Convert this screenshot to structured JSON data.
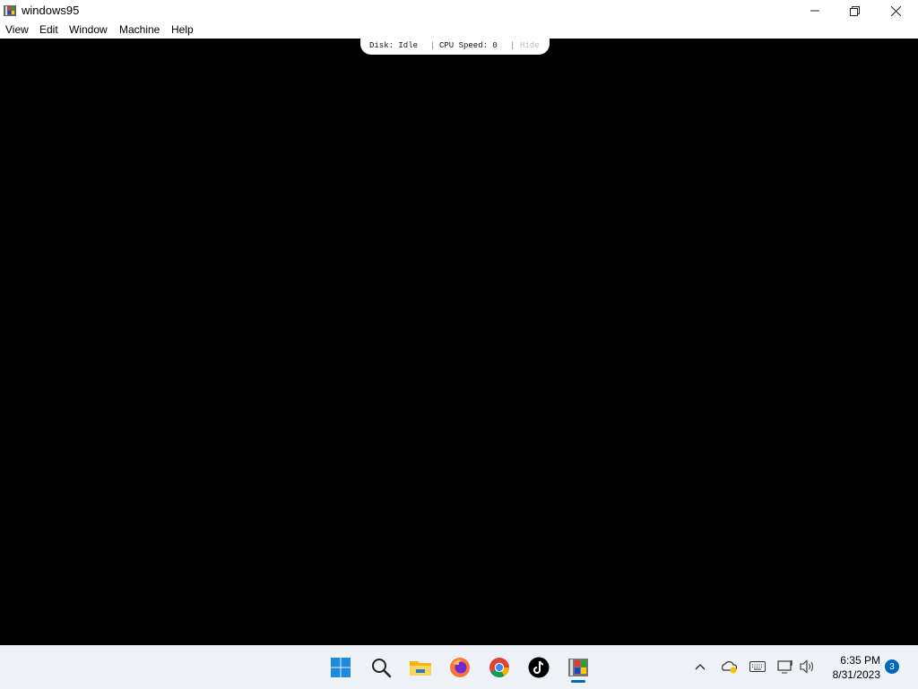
{
  "window": {
    "title": "windows95",
    "icon": "windows95-app-icon",
    "controls": [
      "minimize-icon",
      "restore-icon",
      "close-icon"
    ]
  },
  "menu": [
    "View",
    "Edit",
    "Window",
    "Machine",
    "Help"
  ],
  "status": {
    "disk": "Disk: Idle",
    "separator": "|",
    "cpu": "CPU Speed: 0",
    "hide": "Hide"
  },
  "taskbar": {
    "apps": [
      "start-icon",
      "search-icon",
      "file-explorer-icon",
      "firefox-icon",
      "chrome-icon",
      "tiktok-icon",
      "windows95-app-icon"
    ],
    "tray": [
      "chevron-up-icon",
      "onedrive-icon",
      "keyboard-icon",
      "network-icon",
      "volume-icon"
    ],
    "time": "6:35 PM",
    "date": "8/31/2023",
    "notifications": "3"
  },
  "colors": {
    "screen": "#000000",
    "accent": "#0067c0",
    "taskbar": "#eef2f7"
  }
}
